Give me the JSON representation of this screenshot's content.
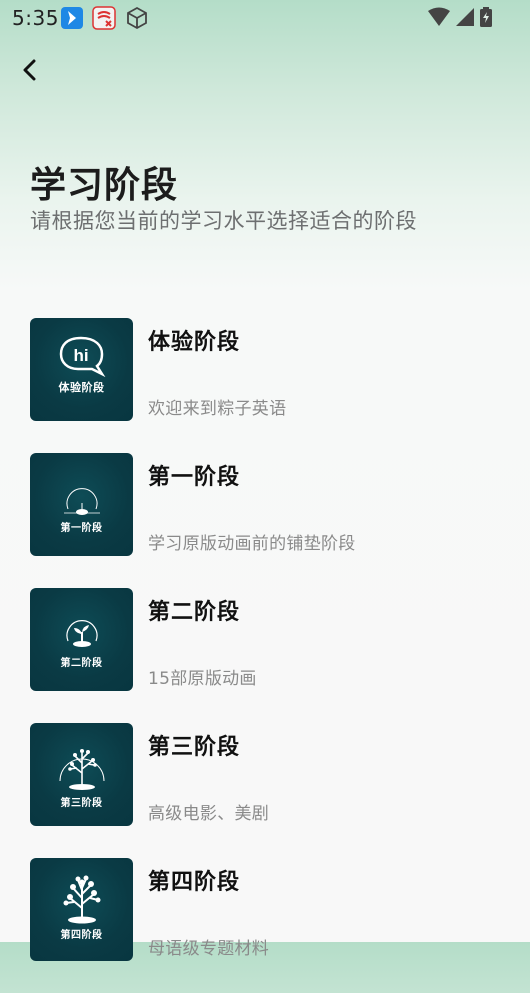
{
  "status_bar": {
    "time": "5:35",
    "left_icons": [
      "app-notification-icon",
      "app-notification-icon-2",
      "cube-icon"
    ],
    "right_icons": [
      "wifi-icon",
      "cell-signal-icon",
      "battery-charging-icon"
    ]
  },
  "header": {
    "back_icon": "chevron-left-icon",
    "title": "学习阶段",
    "subtitle": "请根据您当前的学习水平选择适合的阶段"
  },
  "stages": [
    {
      "name": "体验阶段",
      "description": "欢迎来到粽子英语",
      "thumb_label": "体验阶段",
      "thumb_icon": "hi-bubble-icon"
    },
    {
      "name": "第一阶段",
      "description": "学习原版动画前的铺垫阶段",
      "thumb_label": "第一阶段",
      "thumb_icon": "seed-icon"
    },
    {
      "name": "第二阶段",
      "description": "15部原版动画",
      "thumb_label": "第二阶段",
      "thumb_icon": "sprout-icon"
    },
    {
      "name": "第三阶段",
      "description": "高级电影、美剧",
      "thumb_label": "第三阶段",
      "thumb_icon": "small-tree-icon"
    },
    {
      "name": "第四阶段",
      "description": "母语级专题材料",
      "thumb_label": "第四阶段",
      "thumb_icon": "big-tree-icon"
    }
  ],
  "colors": {
    "thumb_background": "#0a3a44",
    "header_gradient_top": "#b4ddc8",
    "page_background": "#f8f8f8",
    "subtitle_text": "#6d6f70",
    "description_text": "#8a8a8a"
  }
}
